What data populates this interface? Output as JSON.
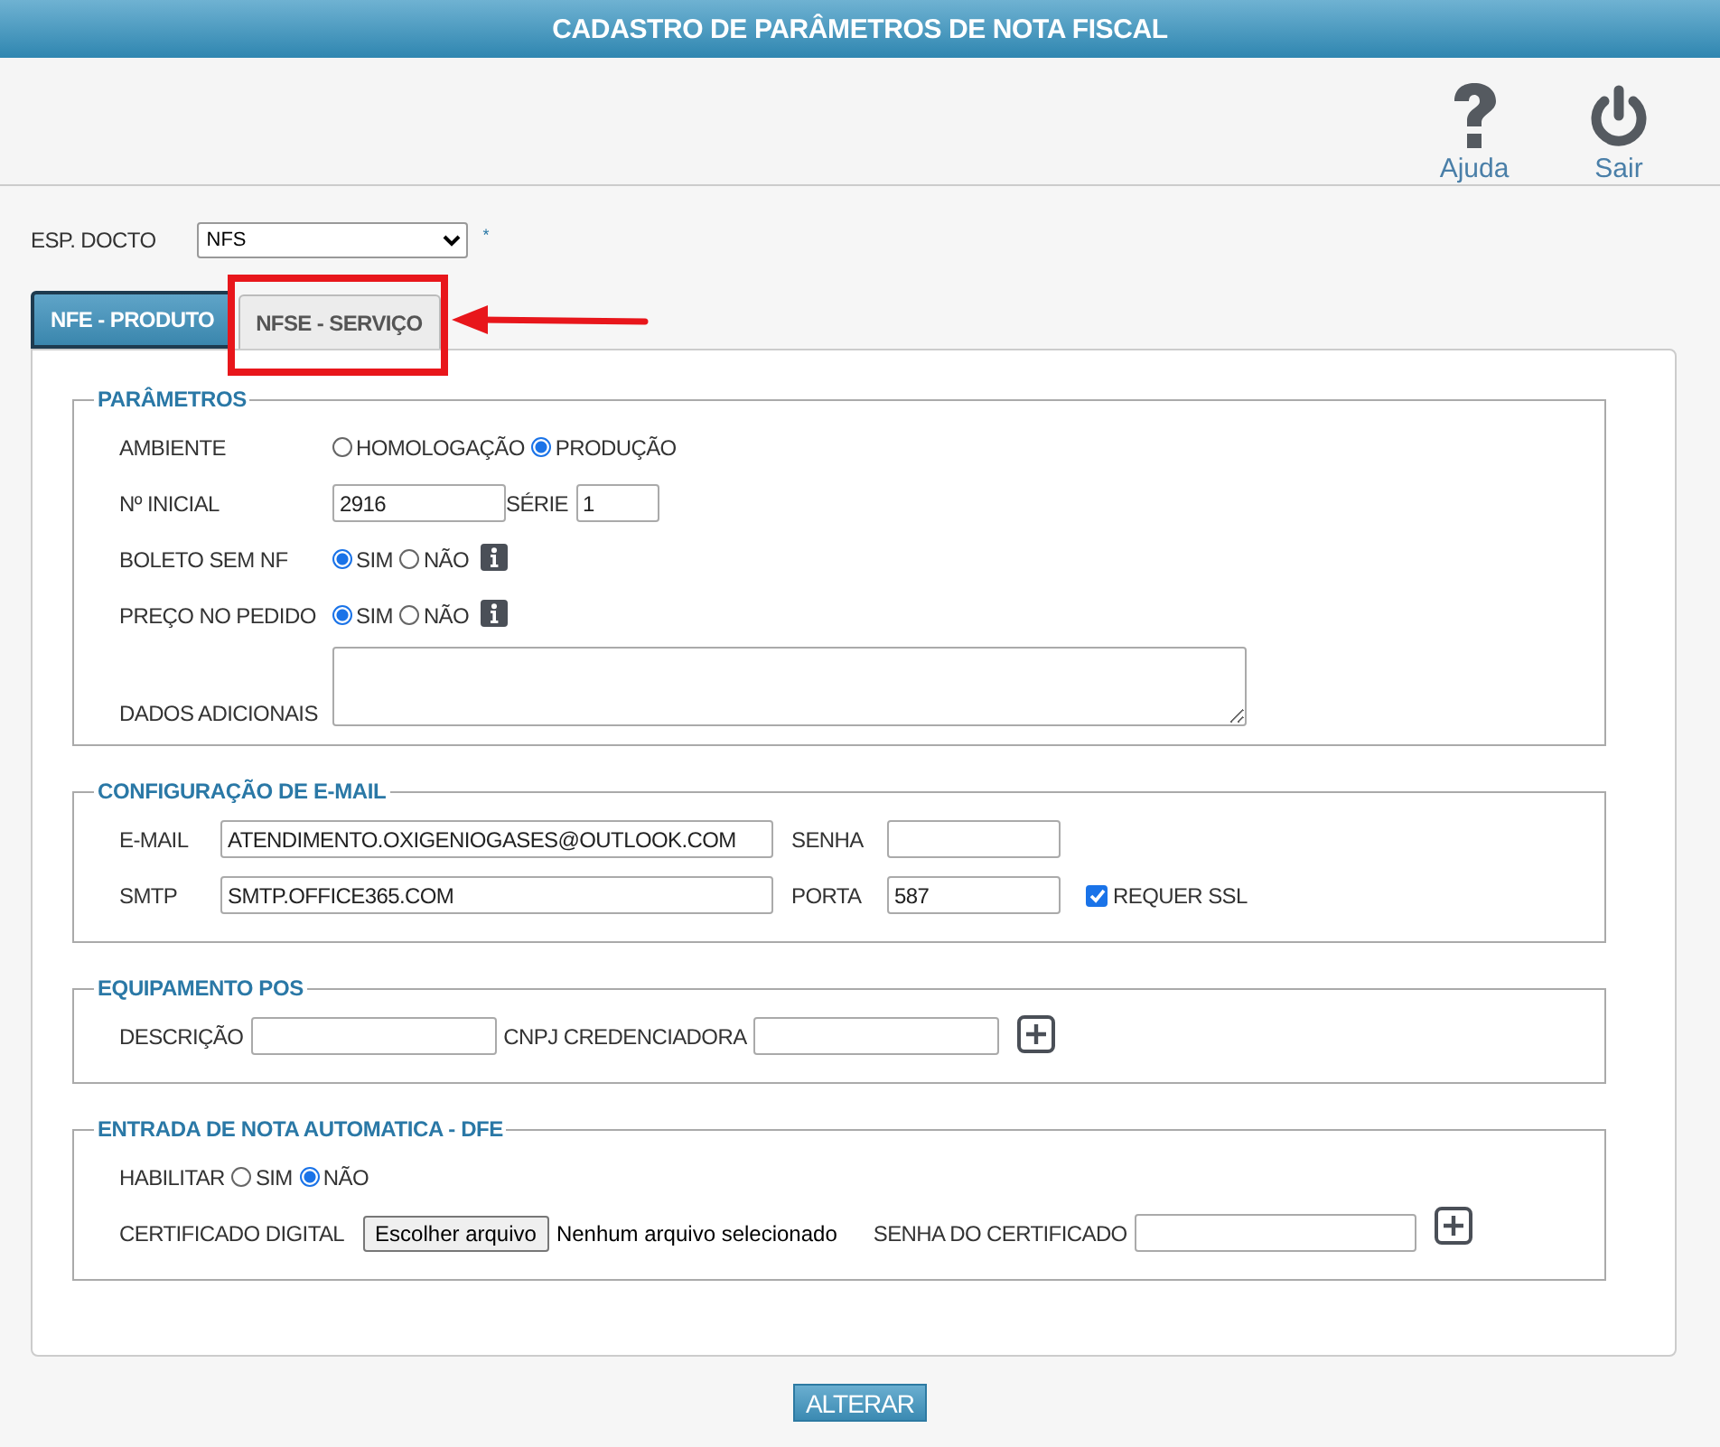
{
  "title": "CADASTRO DE PARÂMETROS DE NOTA FISCAL",
  "toolbar": [
    {
      "kind": "help",
      "label": "Ajuda"
    },
    {
      "kind": "exit",
      "label": "Sair"
    }
  ],
  "doc_type": {
    "label": "ESP. DOCTO",
    "value": "NFS",
    "required_mark": "*"
  },
  "tabs": [
    {
      "label": "NFE - PRODUTO",
      "selected": true
    },
    {
      "label": "NFSE - SERVIÇO",
      "selected": false
    }
  ],
  "annotations": [
    {
      "kind": "callout"
    }
  ],
  "sections": [
    {
      "title": "PARÂMETROS",
      "rows": [
        {
          "label": "AMBIENTE",
          "controls": [
            {
              "kind": "radio",
              "text": "HOMOLOGAÇÃO",
              "selected": false
            },
            {
              "kind": "radio",
              "text": "PRODUÇÃO",
              "selected": true
            }
          ]
        },
        {
          "label": "Nº INICIAL",
          "controls": [
            {
              "kind": "input",
              "value": "2916"
            },
            {
              "kind": "label",
              "text": "SÉRIE"
            },
            {
              "kind": "input",
              "value": "1"
            }
          ]
        },
        {
          "label": "BOLETO SEM NF",
          "controls": [
            {
              "kind": "radio",
              "text": "SIM",
              "selected": true
            },
            {
              "kind": "radio",
              "text": "NÃO",
              "selected": false
            },
            {
              "kind": "info"
            }
          ]
        },
        {
          "label": "PREÇO NO PEDIDO",
          "controls": [
            {
              "kind": "radio",
              "text": "SIM",
              "selected": true
            },
            {
              "kind": "radio",
              "text": "NÃO",
              "selected": false
            },
            {
              "kind": "info"
            }
          ]
        },
        {
          "label": "DADOS ADICIONAIS",
          "controls": [
            {
              "kind": "textarea"
            }
          ]
        }
      ]
    },
    {
      "title": "CONFIGURAÇÃO DE E-MAIL",
      "rows": [
        {
          "label": "E-MAIL",
          "controls": [
            {
              "kind": "input",
              "value": "ATENDIMENTO.OXIGENIOGASES@OUTLOOK.COM"
            },
            {
              "kind": "label",
              "text": "SENHA"
            },
            {
              "kind": "input"
            }
          ]
        },
        {
          "label": "SMTP",
          "controls": [
            {
              "kind": "input",
              "value": "SMTP.OFFICE365.COM"
            },
            {
              "kind": "label",
              "text": "PORTA"
            },
            {
              "kind": "input",
              "value": "587"
            },
            {
              "kind": "checkbox",
              "text": "REQUER SSL",
              "checked": true
            }
          ]
        }
      ]
    },
    {
      "title": "EQUIPAMENTO POS",
      "rows": [
        {
          "label": "DESCRIÇÃO",
          "controls": [
            {
              "kind": "input"
            },
            {
              "kind": "label",
              "text": "CNPJ CREDENCIADORA"
            },
            {
              "kind": "input"
            },
            {
              "kind": "plus"
            }
          ]
        }
      ]
    },
    {
      "title": "ENTRADA DE NOTA AUTOMATICA - DFE",
      "rows": [
        {
          "label": "HABILITAR",
          "controls": [
            {
              "kind": "radio",
              "text": "SIM",
              "selected": false
            },
            {
              "kind": "radio",
              "text": "NÃO",
              "selected": true
            }
          ]
        },
        {
          "label": "CERTIFICADO DIGITAL",
          "controls": [
            {
              "kind": "file",
              "button": "Escolher arquivo",
              "status": "Nenhum arquivo selecionado"
            },
            {
              "kind": "label",
              "text": "SENHA DO CERTIFICADO"
            },
            {
              "kind": "input"
            },
            {
              "kind": "plus"
            }
          ]
        }
      ]
    }
  ],
  "submit": "ALTERAR"
}
